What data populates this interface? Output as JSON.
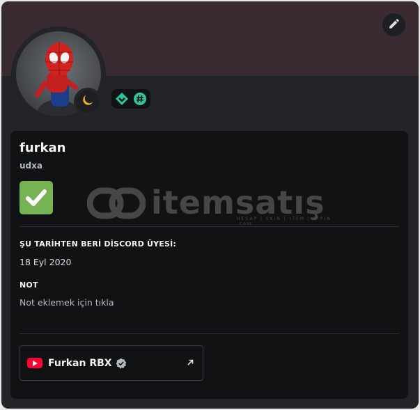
{
  "profile": {
    "display_name": "furkan",
    "username": "udxa",
    "avatar_icon": "spiderman-avatar",
    "status_icon": "moon-idle-icon",
    "badges": [
      {
        "icon": "hypesquad-balance-icon",
        "color": "#2dc39e"
      },
      {
        "icon": "hashtag-badge-icon",
        "color": "#2dc39e"
      }
    ],
    "banner_color": "#3a2a31"
  },
  "about": {
    "emoji": "white-check-mark-emoji"
  },
  "watermark": {
    "text": "itemsatış",
    "subtext": "HESAP | SKIN | ITEM | E-PIN .com"
  },
  "member_since": {
    "title": "ŞU TARİHTEN BERİ DİSCORD ÜYESİ:",
    "value": "18 Eyl 2020"
  },
  "note": {
    "title": "NOT",
    "placeholder": "Not eklemek için tıkla"
  },
  "connections": [
    {
      "service_icon": "youtube-icon",
      "name": "Furkan RBX",
      "verified": true
    }
  ],
  "colors": {
    "accent_green": "#77b255",
    "youtube_red": "#ff0033",
    "status_yellow": "#f0b232"
  }
}
